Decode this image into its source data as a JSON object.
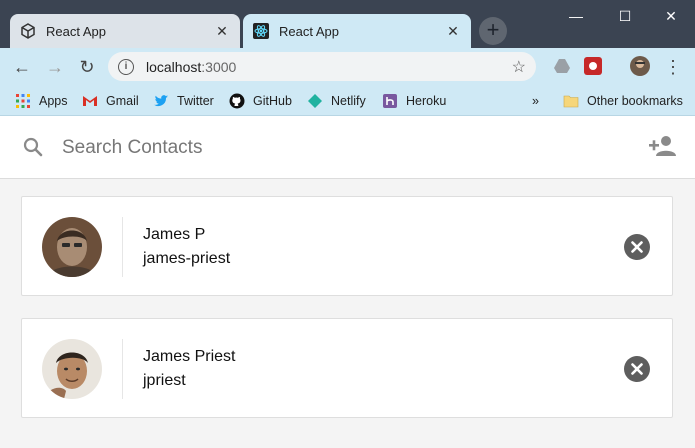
{
  "browser": {
    "tabs": [
      {
        "title": "React App",
        "icon": "cube-icon"
      },
      {
        "title": "React App",
        "icon": "react-icon"
      }
    ],
    "new_tab_label": "+",
    "window_controls": {
      "minimize": "—",
      "maximize": "☐",
      "close": "✕"
    },
    "address": {
      "host": "localhost",
      "port": ":3000"
    },
    "bookmarks": [
      {
        "label": "Apps",
        "icon": "apps-grid-icon"
      },
      {
        "label": "Gmail",
        "icon": "gmail-icon",
        "color": "#d93025"
      },
      {
        "label": "Twitter",
        "icon": "twitter-icon",
        "color": "#1da1f2"
      },
      {
        "label": "GitHub",
        "icon": "github-icon",
        "color": "#111111"
      },
      {
        "label": "Netlify",
        "icon": "netlify-icon",
        "color": "#20b2a0"
      },
      {
        "label": "Heroku",
        "icon": "heroku-icon",
        "color": "#79589f"
      }
    ],
    "overflow_label": "»",
    "other_bookmarks": "Other bookmarks"
  },
  "app": {
    "search": {
      "placeholder": "Search Contacts",
      "value": ""
    },
    "contacts": [
      {
        "name": "James P",
        "handle": "james-priest"
      },
      {
        "name": "James Priest",
        "handle": "jpriest"
      }
    ]
  },
  "colors": {
    "titlebar": "#3b4452",
    "toolbar": "#cfe9f5",
    "remove_button": "#5e5e5e"
  }
}
